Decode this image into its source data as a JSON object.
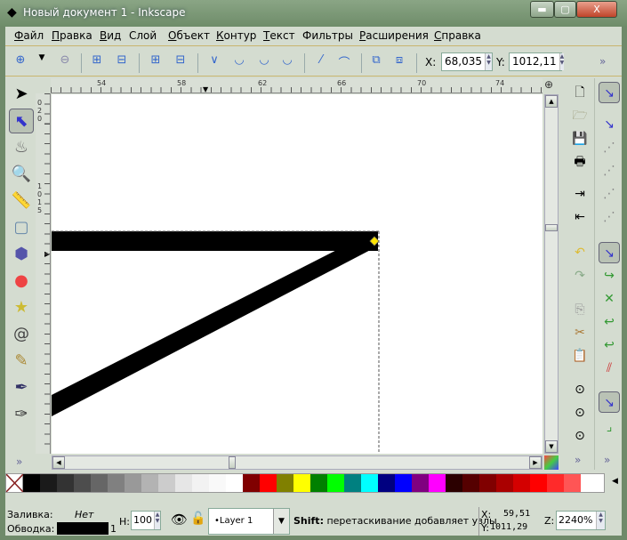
{
  "window": {
    "title": "Новый документ 1 - Inkscape",
    "minimize": "▬",
    "maximize": "▢",
    "close": "X"
  },
  "menu": [
    {
      "u": "Ф",
      "rest": "айл"
    },
    {
      "u": "П",
      "rest": "равка"
    },
    {
      "u": "В",
      "rest": "ид"
    },
    {
      "u": "",
      "rest": "Слой"
    },
    {
      "u": "О",
      "rest": "бъект"
    },
    {
      "u": "К",
      "rest": "онтур"
    },
    {
      "u": "Т",
      "rest": "екст"
    },
    {
      "u": "",
      "rest": "Фильтры"
    },
    {
      "u": "Р",
      "rest": "асширения"
    },
    {
      "u": "С",
      "rest": "правка"
    }
  ],
  "toolbar": {
    "x_label": "X:",
    "x_value": "68,035",
    "y_label": "Y:",
    "y_value": "1012,11",
    "overflow": "»"
  },
  "ruler": {
    "top": [
      "54",
      "58",
      "62",
      "66",
      "70",
      "74"
    ],
    "left": [
      "020",
      "1015"
    ]
  },
  "palette": [
    "#000000",
    "#1a1a1a",
    "#333333",
    "#4d4d4d",
    "#666666",
    "#808080",
    "#999999",
    "#b3b3b3",
    "#cccccc",
    "#e6e6e6",
    "#f2f2f2",
    "#f9f9f9",
    "#ffffff",
    "#800000",
    "#ff0000",
    "#808000",
    "#ffff00",
    "#008000",
    "#00ff00",
    "#008080",
    "#00ffff",
    "#000080",
    "#0000ff",
    "#800080",
    "#ff00ff",
    "#2b0000",
    "#550000",
    "#800000",
    "#aa0000",
    "#d40000",
    "#ff0000",
    "#ff2a2a",
    "#ff5555"
  ],
  "status": {
    "fill_label": "Заливка:",
    "fill_value": "Нет",
    "stroke_label": "Обводка:",
    "stroke_width": "1",
    "stroke_color": "#000000",
    "opacity_label": "H:",
    "opacity_value": "100",
    "layer": "•Layer 1",
    "hint_bold": "Shift:",
    "hint": " перетаскивание добавляет узлы",
    "cx_label": "X:",
    "cx": "59,51",
    "cy_label": "Y:",
    "cy": "1011,29",
    "zoom_label": "Z:",
    "zoom": "2240%"
  },
  "overflow": "»"
}
